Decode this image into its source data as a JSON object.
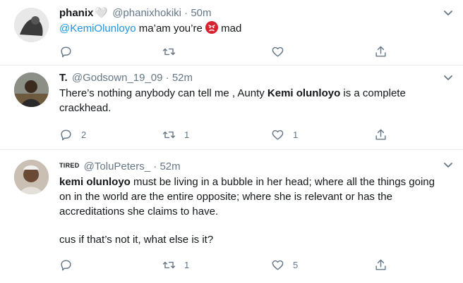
{
  "tweets": [
    {
      "display_name": "phanix",
      "badge": "🤍",
      "handle": "@phanixhokiki",
      "time": "50m",
      "text_mention": "@KemiOlunloyo",
      "text_a": " ma’am you’re ",
      "emoji": "angry-face",
      "text_b": " mad",
      "reply_count": "",
      "retweet_count": "",
      "like_count": ""
    },
    {
      "display_name": "T.",
      "handle": "@Godsown_19_09",
      "time": "52m",
      "text_a": "There’s nothing anybody can tell me , Aunty ",
      "text_bold": "Kemi olunloyo",
      "text_b": " is a complete crackhead.",
      "reply_count": "2",
      "retweet_count": "1",
      "like_count": "1"
    },
    {
      "display_name": "TIRED",
      "handle": "@ToluPeters_",
      "time": "52m",
      "text_bold": "kemi olunloyo",
      "text_a": " must be living in a bubble in her head; where all the things going on in the world are the entire opposite; where she is relevant or has the accreditations she claims to have.",
      "text_b": "cus if that’s not it, what else is it?",
      "reply_count": "",
      "retweet_count": "1",
      "like_count": "5"
    }
  ],
  "colors": {
    "accent": "#1b95e0",
    "muted": "#657786",
    "border": "#e6ecf0",
    "angry": "#d7232f"
  }
}
